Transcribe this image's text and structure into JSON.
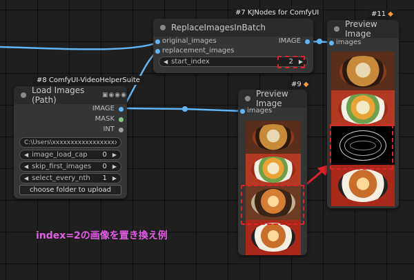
{
  "colors": {
    "image_wire": "#64b5f6",
    "mask_port": "#81c784",
    "int_port": "#9e9e9e",
    "highlight": "#e0232a",
    "annotation": "#e45de6"
  },
  "nodes": {
    "replace": {
      "badge": "#7 KJNodes for ComfyUI",
      "title": "ReplaceImagesInBatch",
      "inputs": [
        "original_images",
        "replacement_images"
      ],
      "output": "IMAGE",
      "start_index": {
        "label": "start_index",
        "value": "2"
      }
    },
    "preview11": {
      "badge": "#11",
      "badge_icon": "fox-icon",
      "title": "Preview Image",
      "input": "images"
    },
    "load": {
      "badge": "#8 ComfyUI-VideoHelperSuite",
      "title": "Load Images (Path)",
      "outputs": [
        "IMAGE",
        "MASK",
        "INT"
      ],
      "path": "C:\\Users\\xxxxxxxxxxxxxxxxxx\\",
      "widgets": [
        {
          "label": "image_load_cap",
          "value": "0"
        },
        {
          "label": "skip_first_images",
          "value": "0"
        },
        {
          "label": "select_every_nth",
          "value": "1"
        }
      ],
      "button": "choose folder to upload"
    },
    "preview9": {
      "badge": "#9",
      "badge_icon": "fox-icon",
      "title": "Preview Image",
      "input": "images"
    }
  },
  "annotation": "index=2の画像を置き換え例"
}
